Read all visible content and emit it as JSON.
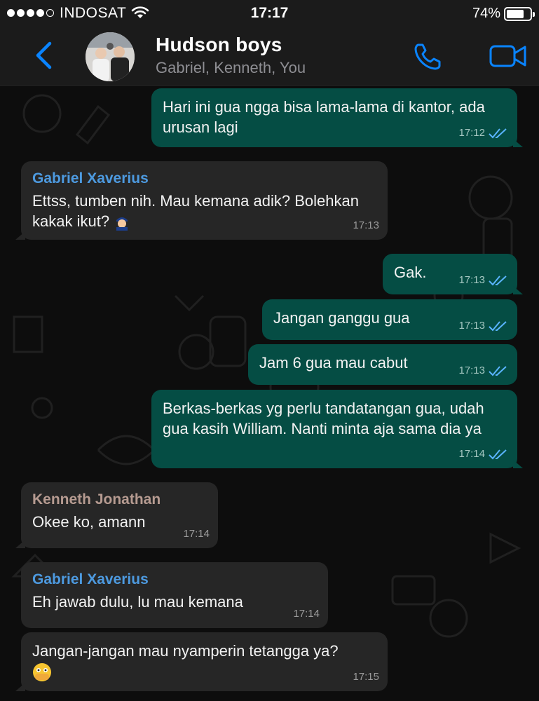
{
  "status_bar": {
    "carrier": "INDOSAT",
    "time": "17:17",
    "battery_percent": "74%",
    "battery_level": 0.74
  },
  "header": {
    "title": "Hudson boys",
    "subtitle": "Gabriel, Kenneth, You",
    "icons": {
      "back": "chevron-left-icon",
      "call": "phone-icon",
      "video": "video-camera-icon"
    },
    "accent_color": "#0a84ff"
  },
  "messages": [
    {
      "direction": "out",
      "text": "Hari ini gua ngga bisa lama-lama di kantor, ada urusan lagi",
      "time": "17:12",
      "status": "read"
    },
    {
      "direction": "in",
      "sender": "Gabriel Xaverius",
      "text": "Ettss, tumben nih. Mau kemana adik? Bolehkan kakak ikut?",
      "emoji": "person-with-police-cap-emoji",
      "time": "17:13"
    },
    {
      "direction": "out",
      "text": "Gak.",
      "time": "17:13",
      "status": "read"
    },
    {
      "direction": "out",
      "text": "Jangan ganggu gua",
      "time": "17:13",
      "status": "read"
    },
    {
      "direction": "out",
      "text": "Jam 6 gua mau cabut",
      "time": "17:13",
      "status": "read"
    },
    {
      "direction": "out",
      "text": "Berkas-berkas yg perlu tandatangan gua, udah gua kasih William. Nanti minta aja sama dia ya",
      "time": "17:14",
      "status": "read"
    },
    {
      "direction": "in",
      "sender": "Kenneth Jonathan",
      "text": "Okee ko, amann",
      "time": "17:14"
    },
    {
      "direction": "in",
      "sender": "Gabriel Xaverius",
      "text": "Eh jawab dulu, lu mau kemana",
      "time": "17:14"
    },
    {
      "direction": "in",
      "text": "Jangan-jangan mau nyamperin tetangga ya?",
      "emoji": "face-with-hand-over-mouth-emoji",
      "time": "17:15"
    }
  ],
  "colors": {
    "outgoing_bubble": "#054d44",
    "incoming_bubble": "#262626",
    "sender_gabriel": "#4d9ae0",
    "sender_kenneth": "#b69b91",
    "read_ticks": "#5ab4ff"
  }
}
